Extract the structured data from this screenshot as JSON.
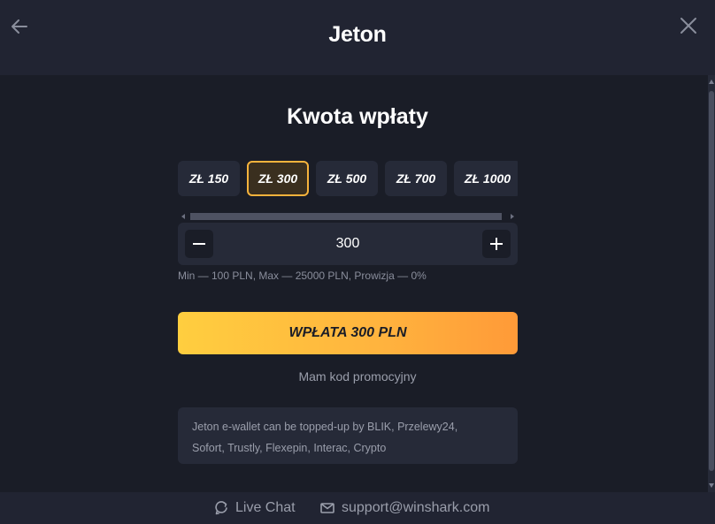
{
  "header": {
    "title": "Jeton",
    "back_icon": "arrow-left-icon",
    "close_icon": "close-icon"
  },
  "main": {
    "section_title": "Kwota wpłaty",
    "amounts": [
      {
        "label": "ZŁ 150",
        "selected": false
      },
      {
        "label": "ZŁ 300",
        "selected": true
      },
      {
        "label": "ZŁ 500",
        "selected": false
      },
      {
        "label": "ZŁ 700",
        "selected": false
      },
      {
        "label": "ZŁ 1000",
        "selected": false
      }
    ],
    "stepper": {
      "value": "300",
      "minus_icon": "minus-icon",
      "plus_icon": "plus-icon"
    },
    "limits_text": "Min — 100 PLN, Max — 25000 PLN, Prowizja — 0%",
    "deposit_button": "WPŁATA 300 PLN",
    "promo_link": "Mam kod promocyjny",
    "info_line1": "Jeton e-wallet can be topped-up by BLIK, Przelewy24,",
    "info_line2": "Sofort, Trustly, Flexepin, Interac, Crypto"
  },
  "footer": {
    "live_chat_label": "Live Chat",
    "live_chat_icon": "chat-icon",
    "support_email": "support@winshark.com",
    "email_icon": "mail-icon"
  },
  "colors": {
    "background": "#1a1d27",
    "panel": "#262a38",
    "header": "#212432",
    "accent": "#f6b33c",
    "gradient_start": "#ffce3f",
    "gradient_end": "#ff9a38",
    "muted_text": "#9a9eab"
  }
}
